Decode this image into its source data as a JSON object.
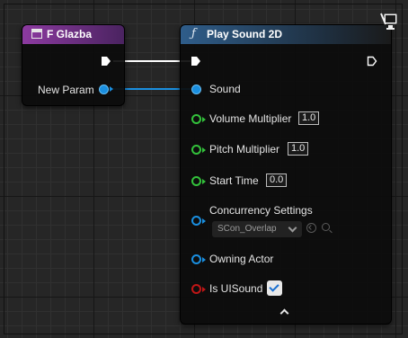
{
  "graph": {
    "getter_node": {
      "title": "F Glazba",
      "output_label": "New Param"
    },
    "play_sound_node": {
      "title": "Play Sound 2D",
      "pins": {
        "sound": {
          "label": "Sound"
        },
        "volume_multiplier": {
          "label": "Volume Multiplier",
          "value": "1.0"
        },
        "pitch_multiplier": {
          "label": "Pitch Multiplier",
          "value": "1.0"
        },
        "start_time": {
          "label": "Start Time",
          "value": "0.0"
        },
        "concurrency_settings": {
          "label": "Concurrency Settings",
          "value": "SCon_Overlap"
        },
        "owning_actor": {
          "label": "Owning Actor"
        },
        "is_ui_sound": {
          "label": "Is UISound",
          "checked": true
        }
      }
    }
  },
  "colors": {
    "getter_header": "#8c3aa0",
    "function_header": "#2f5d8a",
    "object_pin": "#1a8fe0",
    "float_pin": "#33c23b",
    "bool_pin": "#c01616",
    "exec_pin": "#ffffff"
  },
  "icons": [
    "variable-icon",
    "function-icon",
    "exec-pin-icon",
    "client-only-icon",
    "use-selected-icon",
    "browse-icon",
    "advanced-expand-icon",
    "chevron-down-icon",
    "checkmark-icon"
  ]
}
